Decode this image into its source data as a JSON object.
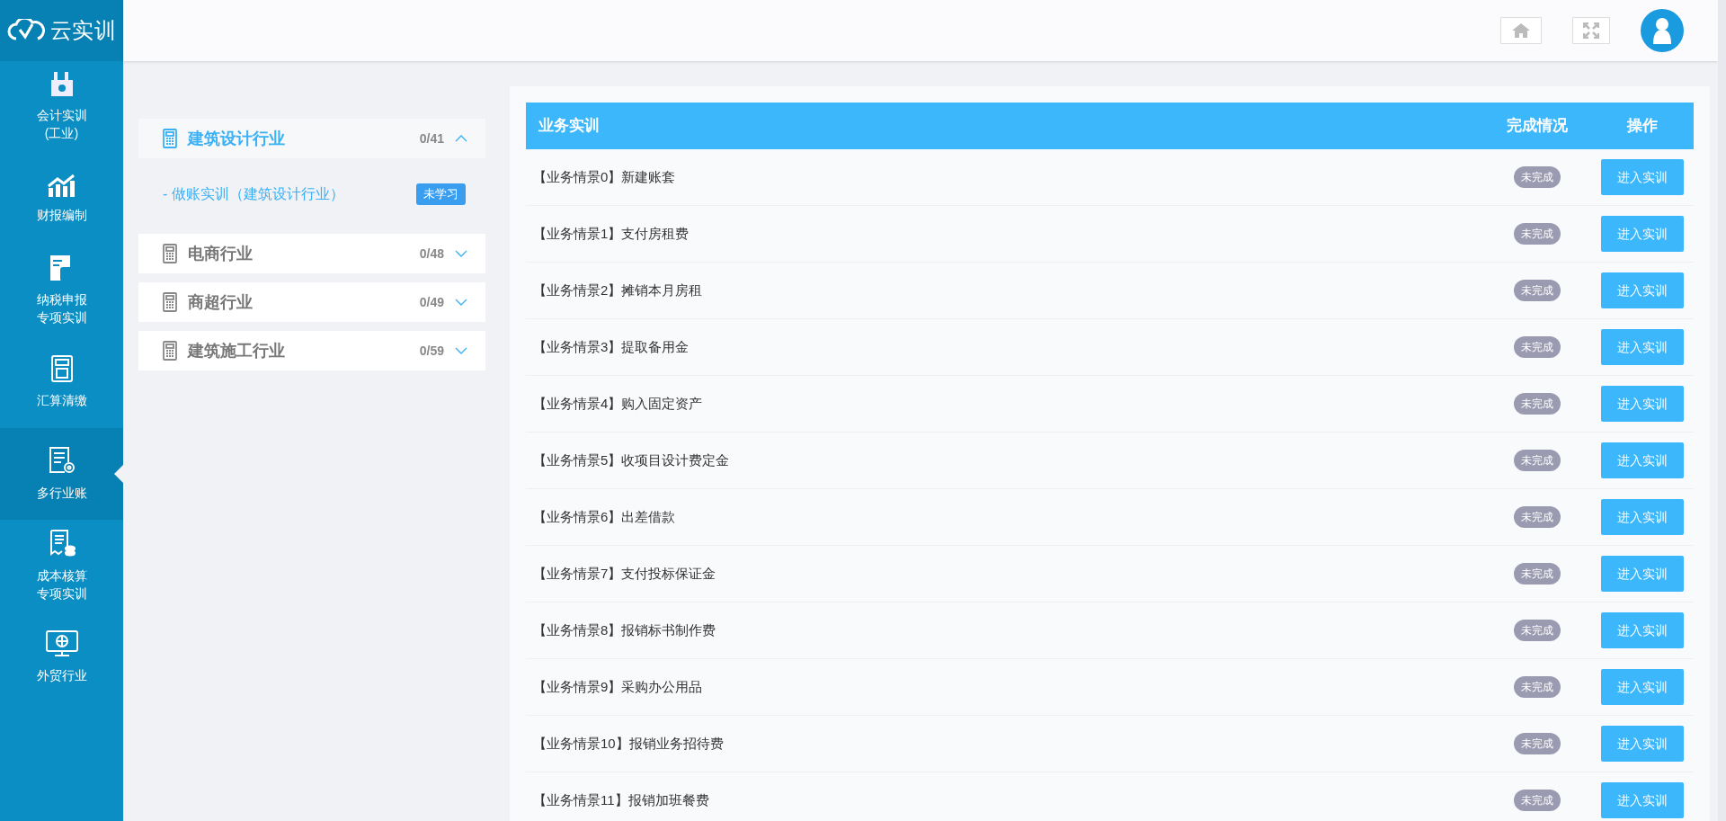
{
  "logo": {
    "text": "云实训"
  },
  "sidebar": {
    "items": [
      {
        "label": "会计实训(工业)",
        "selected": false
      },
      {
        "label": "财报编制",
        "selected": false
      },
      {
        "label": "纳税申报专项实训",
        "selected": false
      },
      {
        "label": "汇算清缴",
        "selected": false
      },
      {
        "label": "多行业账",
        "selected": true
      },
      {
        "label": "成本核算专项实训",
        "selected": false
      },
      {
        "label": "外贸行业",
        "selected": false
      }
    ]
  },
  "categories": [
    {
      "title": "建筑设计行业",
      "count": "0/41",
      "expanded": true,
      "children": [
        {
          "label": "- 做账实训（建筑设计行业）",
          "badge": "未学习"
        }
      ]
    },
    {
      "title": "电商行业",
      "count": "0/48",
      "expanded": false
    },
    {
      "title": "商超行业",
      "count": "0/49",
      "expanded": false
    },
    {
      "title": "建筑施工行业",
      "count": "0/59",
      "expanded": false
    }
  ],
  "table": {
    "columns": [
      "业务实训",
      "完成情况",
      "操作"
    ],
    "rows": [
      {
        "name": "【业务情景0】新建账套",
        "status": "未完成",
        "action": "进入实训"
      },
      {
        "name": "【业务情景1】支付房租费",
        "status": "未完成",
        "action": "进入实训"
      },
      {
        "name": "【业务情景2】摊销本月房租",
        "status": "未完成",
        "action": "进入实训"
      },
      {
        "name": "【业务情景3】提取备用金",
        "status": "未完成",
        "action": "进入实训"
      },
      {
        "name": "【业务情景4】购入固定资产",
        "status": "未完成",
        "action": "进入实训"
      },
      {
        "name": "【业务情景5】收项目设计费定金",
        "status": "未完成",
        "action": "进入实训"
      },
      {
        "name": "【业务情景6】出差借款",
        "status": "未完成",
        "action": "进入实训"
      },
      {
        "name": "【业务情景7】支付投标保证金",
        "status": "未完成",
        "action": "进入实训"
      },
      {
        "name": "【业务情景8】报销标书制作费",
        "status": "未完成",
        "action": "进入实训"
      },
      {
        "name": "【业务情景9】采购办公用品",
        "status": "未完成",
        "action": "进入实训"
      },
      {
        "name": "【业务情景10】报销业务招待费",
        "status": "未完成",
        "action": "进入实训"
      },
      {
        "name": "【业务情景11】报销加班餐费",
        "status": "未完成",
        "action": "进入实训"
      }
    ]
  }
}
